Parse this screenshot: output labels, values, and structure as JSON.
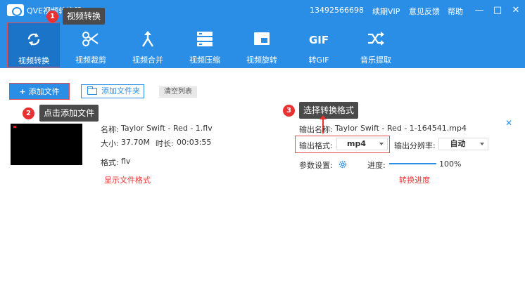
{
  "titlebar": {
    "app_title": "QVE视频转换器",
    "phone": "13492566698",
    "links": [
      "续期VIP",
      "意见反馈",
      "帮助"
    ],
    "controls": [
      "—",
      "□",
      "✕"
    ]
  },
  "toolbar": [
    {
      "label": "视频转换",
      "icon": "convert-icon",
      "active": true
    },
    {
      "label": "视频裁剪",
      "icon": "scissors-icon",
      "active": false
    },
    {
      "label": "视频合并",
      "icon": "merge-icon",
      "active": false
    },
    {
      "label": "视频压缩",
      "icon": "compress-icon",
      "active": false
    },
    {
      "label": "视频旋转",
      "icon": "rotate-icon",
      "active": false
    },
    {
      "label": "转GIF",
      "icon": "gif-icon",
      "active": false
    },
    {
      "label": "音乐提取",
      "icon": "shuffle-icon",
      "active": false
    }
  ],
  "actions": {
    "add_file": "添加文件",
    "add_folder": "添加文件夹",
    "clear_list": "清空列表"
  },
  "annotations": {
    "badge1": "1",
    "tip1": "视频转换",
    "badge2": "2",
    "tip2": "点击添加文件",
    "badge3": "3",
    "tip3": "选择转换格式",
    "note_format": "显示文件格式",
    "note_progress": "转换进度"
  },
  "file": {
    "name_label": "名称:",
    "name": "Taylor Swift - Red - 1.flv",
    "size_label": "大小:",
    "size": "37.70M",
    "duration_label": "时长:",
    "duration": "00:03:55",
    "format_label": "格式:",
    "format": "flv",
    "output_name_label": "输出名称:",
    "output_name": "Taylor Swift - Red - 1-164541.mp4",
    "output_format_label": "输出格式:",
    "output_format": "mp4",
    "resolution_label": "输出分辨率:",
    "resolution": "自动",
    "params_label": "参数设置:",
    "progress_label": "进度:",
    "progress_text": "100%",
    "progress_value": 1.0
  },
  "colors": {
    "brand": "#2a8ee6",
    "annotation": "#e83232"
  }
}
